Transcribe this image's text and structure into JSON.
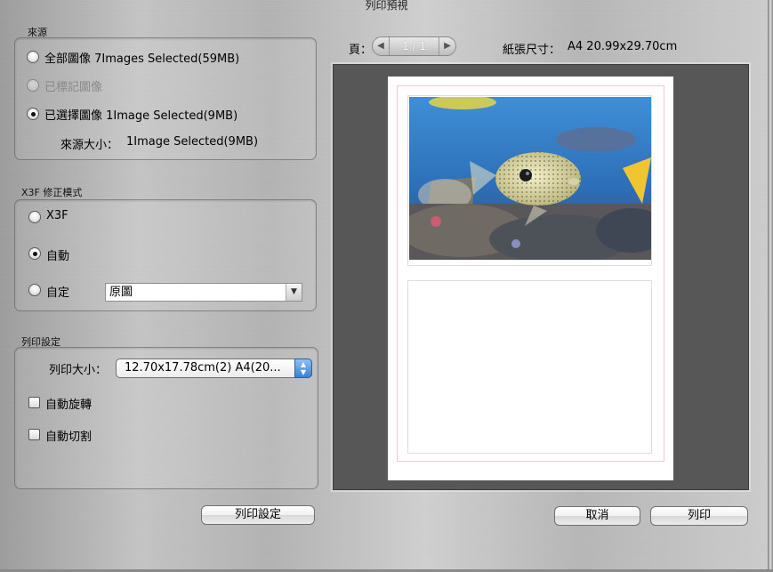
{
  "window": {
    "title": "列印預視"
  },
  "source": {
    "section_label": "來源",
    "options": [
      {
        "label": "全部圖像 7Images Selected(59MB)",
        "checked": false,
        "disabled": false
      },
      {
        "label": "已標記圖像",
        "checked": false,
        "disabled": true
      },
      {
        "label": "已選擇圖像 1Image Selected(9MB)",
        "checked": true,
        "disabled": false
      }
    ],
    "size_label": "來源大小：",
    "size_value": "1Image Selected(9MB)"
  },
  "x3f": {
    "section_label": "X3F 修正模式",
    "options": [
      {
        "label": "X3F",
        "checked": false
      },
      {
        "label": "自動",
        "checked": true
      },
      {
        "label": "自定",
        "checked": false
      }
    ],
    "custom_select": {
      "value": "原圖"
    }
  },
  "print_settings": {
    "section_label": "列印設定",
    "size_label": "列印大小：",
    "size_value": "12.70x17.78cm(2) A4(20...",
    "auto_rotate": {
      "label": "自動旋轉",
      "checked": false
    },
    "auto_crop": {
      "label": "自動切割",
      "checked": false
    }
  },
  "preview": {
    "page_label": "頁：",
    "page_indicator": "1 / 1",
    "paper_size_label": "紙張尺寸：",
    "paper_size_value": "A4  20.99x29.70cm"
  },
  "buttons": {
    "print_setup": "列印設定",
    "cancel": "取消",
    "print": "列印"
  },
  "colors": {
    "accent_blue": "#3a7fd8",
    "preview_bg": "#575757",
    "margin_line": "#f2c9cf"
  },
  "icons": {
    "pager_prev": "chevron-left-icon",
    "pager_next": "chevron-right-icon",
    "select_arrow": "chevron-down-icon",
    "popup_stepper": "up-down-stepper-icon"
  }
}
